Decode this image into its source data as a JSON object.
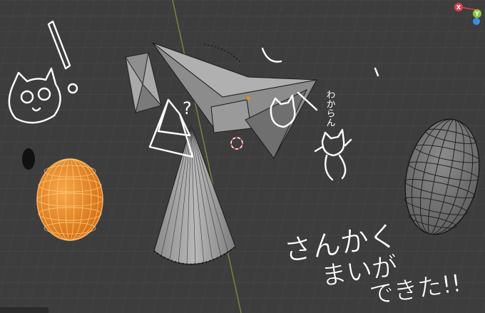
{
  "viewport": {
    "background": "#3d3d3d",
    "grid_color": "#4a4a4a",
    "axis_y_color": "#7a8a3a",
    "selection_color": "#f08a1c"
  },
  "gizmo": {
    "x_label": "X",
    "y_label": "Y",
    "x_color": "#d9414e",
    "y_color": "#8cc63f",
    "z_color": "#3a8ee6"
  },
  "annotations": {
    "question_mark": "?",
    "wakaran": "わからん",
    "line1": "さんかく",
    "line2": "まいが",
    "line3": "できた!!"
  },
  "objects": [
    {
      "name": "wedge-prism",
      "selected": false
    },
    {
      "name": "triangle-plane",
      "selected": false
    },
    {
      "name": "cone",
      "selected": false
    },
    {
      "name": "uv-sphere-orange",
      "selected": true
    },
    {
      "name": "elongated-sphere",
      "selected": false
    }
  ]
}
